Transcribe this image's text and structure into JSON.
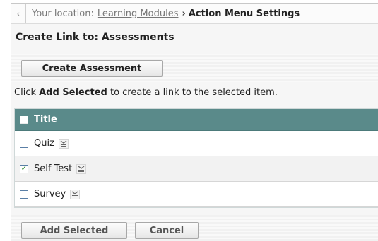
{
  "breadcrumb": {
    "back_icon": "chevron-left-icon",
    "prefix": "Your location:",
    "link": "Learning Modules",
    "separator": "›",
    "current": "Action Menu Settings"
  },
  "page": {
    "title": "Create Link to: Assessments"
  },
  "toolbar": {
    "create_label": "Create Assessment"
  },
  "instructions": {
    "before": "Click",
    "bold": "Add Selected",
    "after": "to create a link to the selected item."
  },
  "table": {
    "header": "Title",
    "header_color": "#5a8a8a",
    "rows": [
      {
        "label": "Quiz",
        "checked": false,
        "menu_icon": "action-menu-icon"
      },
      {
        "label": "Self Test",
        "checked": true,
        "menu_icon": "action-menu-icon"
      },
      {
        "label": "Survey",
        "checked": false,
        "menu_icon": "action-menu-icon"
      }
    ]
  },
  "actions": {
    "add_label": "Add Selected",
    "cancel_label": "Cancel"
  }
}
